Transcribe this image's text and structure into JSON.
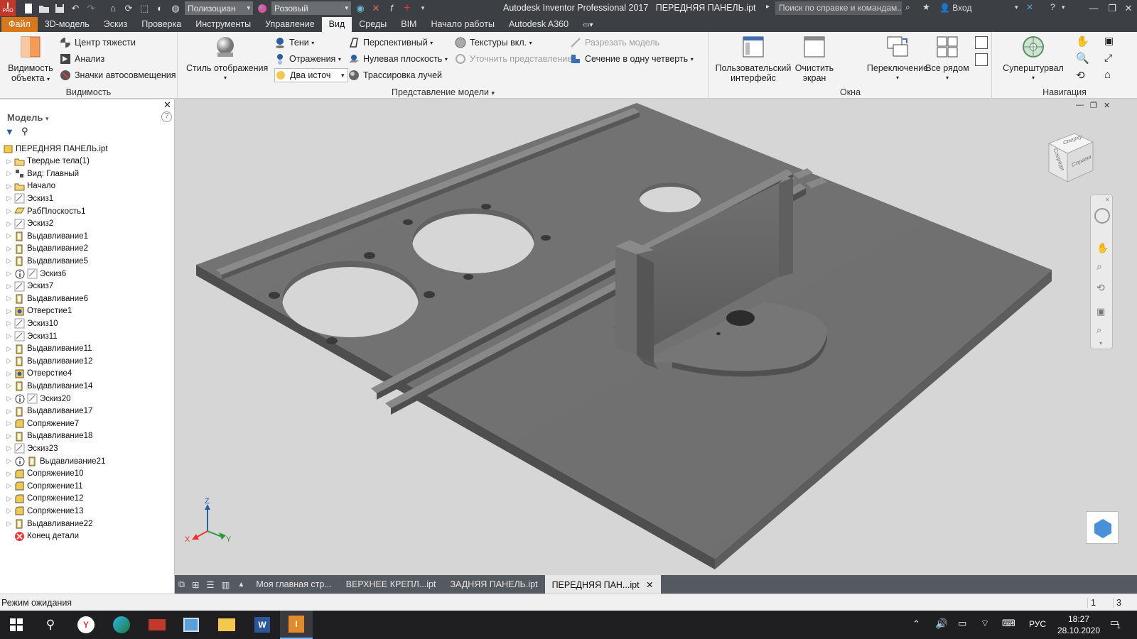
{
  "title_bar": {
    "app_title": "Autodesk Inventor Professional 2017",
    "doc_title": "ПЕРЕДНЯЯ ПАНЕЛЬ.ipt",
    "material_combo": "Полизоциан",
    "appearance_combo": "Розовый",
    "help_search_placeholder": "Поиск по справке и командам...",
    "sign_in": "Вход",
    "pro_badge": "PRO"
  },
  "menu_tabs": [
    {
      "label": "Файл"
    },
    {
      "label": "3D-модель"
    },
    {
      "label": "Эскиз"
    },
    {
      "label": "Проверка"
    },
    {
      "label": "Инструменты"
    },
    {
      "label": "Управление"
    },
    {
      "label": "Вид"
    },
    {
      "label": "Среды"
    },
    {
      "label": "BIM"
    },
    {
      "label": "Начало работы"
    },
    {
      "label": "Autodesk A360"
    }
  ],
  "active_tab": "Вид",
  "ribbon": {
    "visibility": {
      "big_label_1": "Видимость",
      "big_label_2": "объекта",
      "center_gravity": "Центр тяжести",
      "analysis": "Анализ",
      "snap_icons": "Значки автосовмещения",
      "group_label": "Видимость"
    },
    "model_view": {
      "display_style_label": "Стиль отображения",
      "shadows": "Тени",
      "reflections": "Отражения",
      "two_lights": "Два источ",
      "perspective": "Перспективный",
      "ground_plane": "Нулевая плоскость",
      "ray_tracing": "Трассировка лучей",
      "textures": "Текстуры вкл.",
      "refine_view": "Уточнить представление",
      "cut_model": "Разрезать модель",
      "quarter_section": "Сечение в одну четверть",
      "group_label": "Представление модели"
    },
    "windows": {
      "user_interface_1": "Пользовательский",
      "user_interface_2": "интерфейс",
      "clean_screen_1": "Очистить",
      "clean_screen_2": "экран",
      "switch": "Переключение",
      "tile_all": "Все рядом",
      "group_label": "Окна"
    },
    "navigation": {
      "steering_wheel": "Суперштурвал",
      "group_label": "Навигация"
    }
  },
  "browser": {
    "header": "Модель",
    "tree": [
      {
        "label": "ПЕРЕДНЯЯ ПАНЕЛЬ.ipt",
        "icon": "part-icon",
        "level": 0
      },
      {
        "label": "Твердые тела(1)",
        "icon": "solid-bodies-icon",
        "level": 1
      },
      {
        "label": "Вид: Главный",
        "icon": "view-rep-icon",
        "level": 1
      },
      {
        "label": "Начало",
        "icon": "folder-icon",
        "level": 1
      },
      {
        "label": "Эскиз1",
        "icon": "sketch-icon",
        "level": 1
      },
      {
        "label": "РабПлоскость1",
        "icon": "work-plane-icon",
        "level": 1
      },
      {
        "label": "Эскиз2",
        "icon": "sketch-icon",
        "level": 1
      },
      {
        "label": "Выдавливание1",
        "icon": "extrude-icon",
        "level": 1
      },
      {
        "label": "Выдавливание2",
        "icon": "extrude-icon",
        "level": 1
      },
      {
        "label": "Выдавливание5",
        "icon": "extrude-icon",
        "level": 1
      },
      {
        "label": "Эскиз6",
        "icon": "sketch-icon",
        "level": 1,
        "info": true
      },
      {
        "label": "Эскиз7",
        "icon": "sketch-icon",
        "level": 1
      },
      {
        "label": "Выдавливание6",
        "icon": "extrude-icon",
        "level": 1
      },
      {
        "label": "Отверстие1",
        "icon": "hole-icon",
        "level": 1
      },
      {
        "label": "Эскиз10",
        "icon": "sketch-icon",
        "level": 1
      },
      {
        "label": "Эскиз11",
        "icon": "sketch-icon",
        "level": 1
      },
      {
        "label": "Выдавливание11",
        "icon": "extrude-icon",
        "level": 1
      },
      {
        "label": "Выдавливание12",
        "icon": "extrude-icon",
        "level": 1
      },
      {
        "label": "Отверстие4",
        "icon": "hole-icon",
        "level": 1
      },
      {
        "label": "Выдавливание14",
        "icon": "extrude-icon",
        "level": 1
      },
      {
        "label": "Эскиз20",
        "icon": "sketch-icon",
        "level": 1,
        "info": true
      },
      {
        "label": "Выдавливание17",
        "icon": "extrude-icon",
        "level": 1
      },
      {
        "label": "Сопряжение7",
        "icon": "fillet-icon",
        "level": 1
      },
      {
        "label": "Выдавливание18",
        "icon": "extrude-icon",
        "level": 1
      },
      {
        "label": "Эскиз23",
        "icon": "sketch-icon",
        "level": 1
      },
      {
        "label": "Выдавливание21",
        "icon": "extrude-icon",
        "level": 1,
        "info": true
      },
      {
        "label": "Сопряжение10",
        "icon": "fillet-icon",
        "level": 1
      },
      {
        "label": "Сопряжение11",
        "icon": "fillet-icon",
        "level": 1
      },
      {
        "label": "Сопряжение12",
        "icon": "fillet-icon",
        "level": 1
      },
      {
        "label": "Сопряжение13",
        "icon": "fillet-icon",
        "level": 1
      },
      {
        "label": "Выдавливание22",
        "icon": "extrude-icon",
        "level": 1
      },
      {
        "label": "Конец детали",
        "icon": "end-of-part-icon",
        "level": 1
      }
    ]
  },
  "viewcube": {
    "front": "Спереди",
    "right": "Справа",
    "top": "Сверху"
  },
  "triad": {
    "x": "X",
    "y": "Y",
    "z": "Z"
  },
  "doc_tabs": [
    {
      "label": "Моя главная стр..."
    },
    {
      "label": "ВЕРХНЕЕ КРЕПЛ...ipt"
    },
    {
      "label": "ЗАДНЯЯ ПАНЕЛЬ.ipt"
    },
    {
      "label": "ПЕРЕДНЯЯ ПАН...ipt"
    }
  ],
  "status": {
    "text": "Режим ожидания",
    "count1": "1",
    "count2": "3"
  },
  "taskbar": {
    "language": "РУС",
    "time": "18:27",
    "date": "28.10.2020",
    "notifications": "1"
  },
  "colors": {
    "accent": "#d8781d",
    "titlebar": "#3c3f44",
    "ribbon": "#f3f3f3",
    "model": "#7a7a7a"
  }
}
